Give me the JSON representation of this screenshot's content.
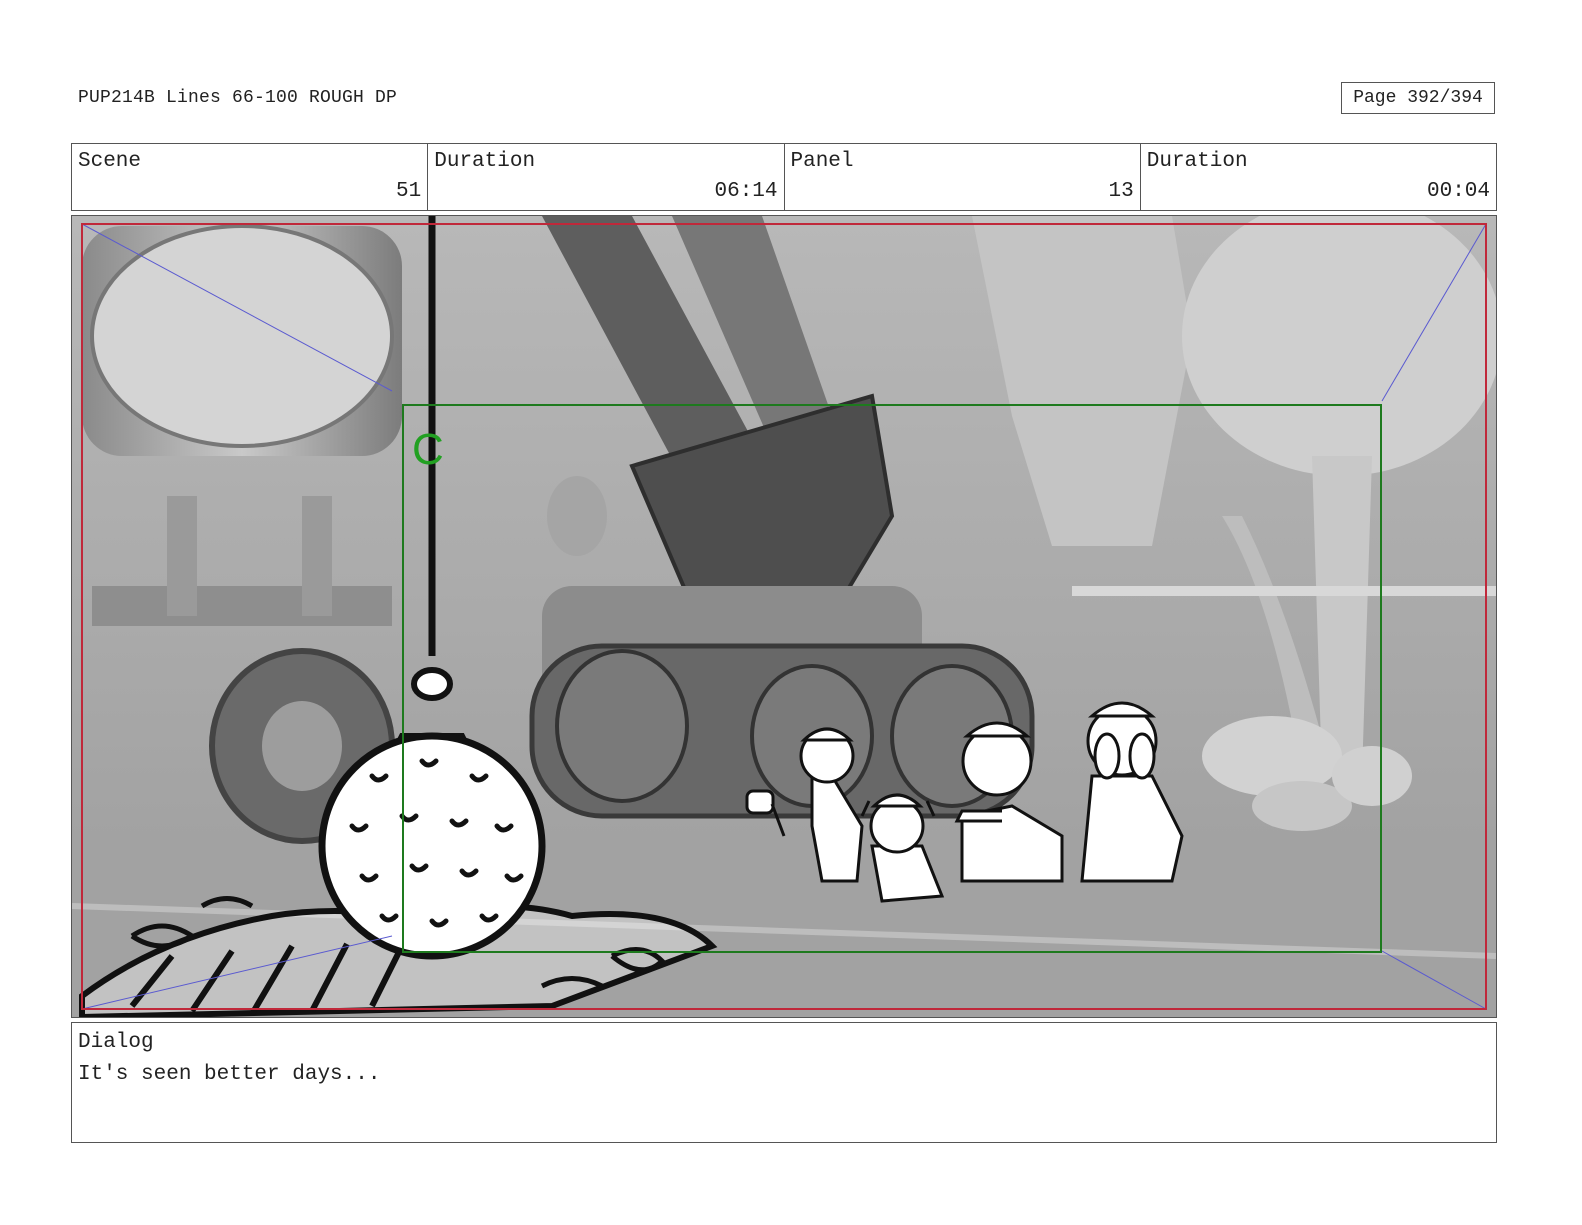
{
  "header": {
    "title": "PUP214B Lines 66-100 ROUGH DP",
    "page": "Page 392/394"
  },
  "info": {
    "scene_label": "Scene",
    "scene_value": "51",
    "scene_duration_label": "Duration",
    "scene_duration_value": "06:14",
    "panel_label": "Panel",
    "panel_value": "13",
    "panel_duration_label": "Duration",
    "panel_duration_value": "00:04"
  },
  "panel": {
    "camera_marker": "C",
    "colors": {
      "safe_frame": "#c0283a",
      "camera_frame": "#1e7a1e",
      "guide_lines": "#5a5ad0",
      "background": "#a9a9a9"
    }
  },
  "dialog": {
    "label": "Dialog",
    "text": "It's seen better days..."
  }
}
